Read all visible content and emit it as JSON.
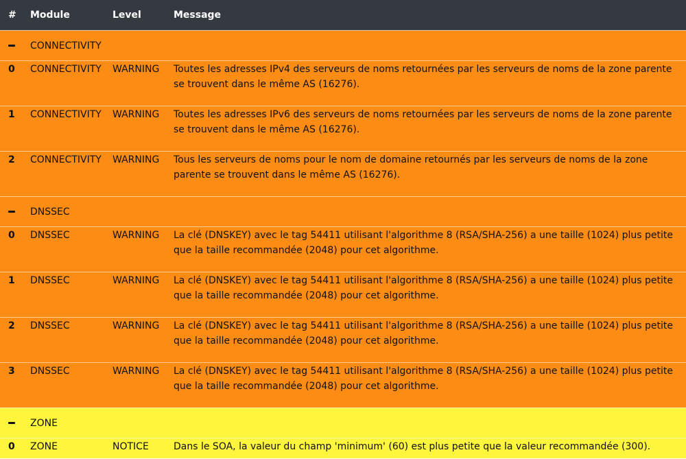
{
  "colors": {
    "header_bg": "#343a40",
    "warning_bg": "#fd8c14",
    "notice_bg": "#fdf63c"
  },
  "header": {
    "num": "#",
    "module": "Module",
    "level": "Level",
    "message": "Message"
  },
  "groups": [
    {
      "name": "CONNECTIVITY",
      "toggle_icon": "minus-icon",
      "rows": [
        {
          "num": "0",
          "module": "CONNECTIVITY",
          "level": "WARNING",
          "message": "Toutes les adresses IPv4 des serveurs de noms retournées par les serveurs de noms de la zone parente se trouvent dans le même AS (16276)."
        },
        {
          "num": "1",
          "module": "CONNECTIVITY",
          "level": "WARNING",
          "message": "Toutes les adresses IPv6 des serveurs de noms retournées par les serveurs de noms de la zone parente se trouvent dans le même AS (16276)."
        },
        {
          "num": "2",
          "module": "CONNECTIVITY",
          "level": "WARNING",
          "message": "Tous les serveurs de noms pour le nom de domaine retournés par les serveurs de noms de la zone parente se trouvent dans le même AS (16276)."
        }
      ]
    },
    {
      "name": "DNSSEC",
      "toggle_icon": "minus-icon",
      "rows": [
        {
          "num": "0",
          "module": "DNSSEC",
          "level": "WARNING",
          "message": "La clé (DNSKEY) avec le tag 54411 utilisant l'algorithme 8 (RSA/SHA-256) a une taille (1024) plus petite que la taille recommandée (2048) pour cet algorithme."
        },
        {
          "num": "1",
          "module": "DNSSEC",
          "level": "WARNING",
          "message": "La clé (DNSKEY) avec le tag 54411 utilisant l'algorithme 8 (RSA/SHA-256) a une taille (1024) plus petite que la taille recommandée (2048) pour cet algorithme."
        },
        {
          "num": "2",
          "module": "DNSSEC",
          "level": "WARNING",
          "message": "La clé (DNSKEY) avec le tag 54411 utilisant l'algorithme 8 (RSA/SHA-256) a une taille (1024) plus petite que la taille recommandée (2048) pour cet algorithme."
        },
        {
          "num": "3",
          "module": "DNSSEC",
          "level": "WARNING",
          "message": "La clé (DNSKEY) avec le tag 54411 utilisant l'algorithme 8 (RSA/SHA-256) a une taille (1024) plus petite que la taille recommandée (2048) pour cet algorithme."
        }
      ]
    },
    {
      "name": "ZONE",
      "toggle_icon": "minus-icon",
      "rows": [
        {
          "num": "0",
          "module": "ZONE",
          "level": "NOTICE",
          "message": "Dans le SOA, la valeur du champ 'minimum' (60) est plus petite que la valeur recommandée (300)."
        }
      ]
    }
  ]
}
